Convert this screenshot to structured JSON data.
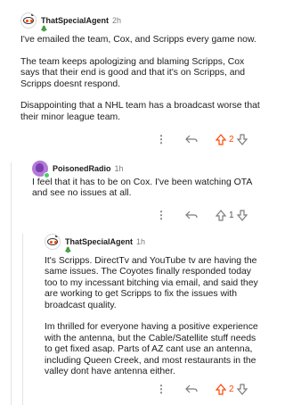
{
  "comments": [
    {
      "username": "ThatSpecialAgent",
      "time": "2h",
      "flair": "🎄",
      "body": "I've emailed the team, Cox, and Scripps every game now.\n\nThe team keeps apologizing and blaming Scripps, Cox says that their end is good and that it's on Scripps, and Scripps doesnt respond.\n\nDisappointing that a NHL team has a broadcast worse that their minor league team.",
      "score": "2",
      "upvoted": true,
      "avatar": "snoo-avatar"
    },
    {
      "username": "PoisonedRadio",
      "time": "1h",
      "body": "I feel that it has to be on Cox. I've been watching OTA and see no issues at all.",
      "score": "1",
      "upvoted": false,
      "avatar": "purple-avatar",
      "online": true
    },
    {
      "username": "ThatSpecialAgent",
      "time": "1h",
      "flair": "🎄",
      "body": "It's Scripps. DirectTv and YouTube tv are having the same issues. The Coyotes finally responded today too to my incessant bitching via email, and said they are working to get Scripps to fix the issues with broadcast quality.\n\nIm thrilled for everyone having a positive experience with the antenna, but the Cable/Satellite stuff needs to get fixed asap. Parts of AZ cant use an antenna, including Queen Creek, and most restaurants in the valley dont have antenna either.",
      "score": "2",
      "upvoted": true,
      "avatar": "snoo-avatar"
    }
  ],
  "icons": {
    "more": "⋮",
    "reply": "reply-arrow-icon",
    "upvote": "upvote-arrow-icon",
    "downvote": "downvote-arrow-icon"
  },
  "colors": {
    "upvote": "#ff4500",
    "muted": "#7c7c7c",
    "online": "#46d160"
  }
}
